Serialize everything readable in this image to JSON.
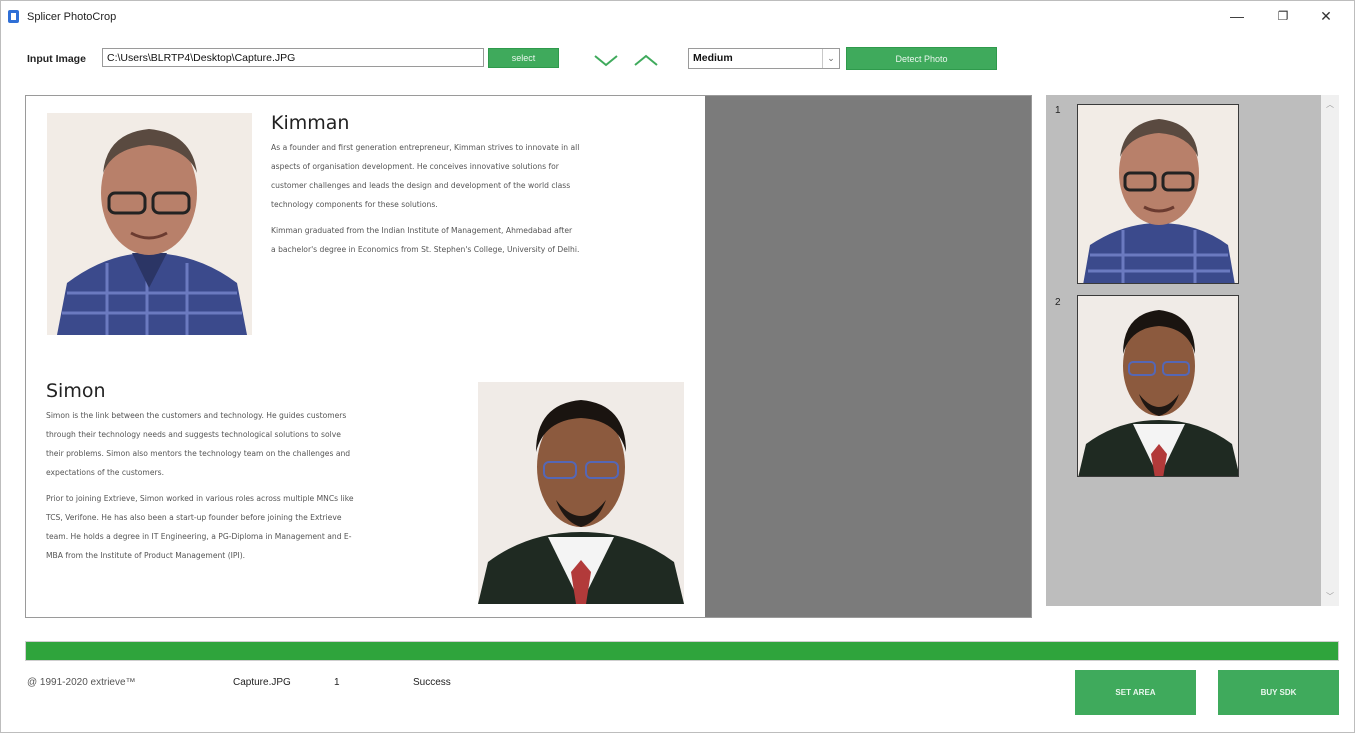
{
  "window": {
    "title": "Splicer PhotoCrop",
    "minimize": "—",
    "restore": "❐",
    "close": "✕"
  },
  "toolbar": {
    "input_label": "Input Image",
    "input_path": "C:\\Users\\BLRTP4\\Desktop\\Capture.JPG",
    "select_label": "select",
    "quality_value": "Medium",
    "detect_label": "Detect Photo"
  },
  "document": {
    "person1": {
      "name": "Kimman",
      "lines": [
        "As a founder and first generation entrepreneur, Kimman strives to innovate in all",
        "aspects of organisation development. He conceives innovative solutions for",
        "customer challenges and leads the design and development of the world class",
        "technology components for these solutions.",
        "Kimman graduated from the Indian Institute of Management, Ahmedabad after",
        "a bachelor's degree in Economics from St. Stephen's College, University of Delhi."
      ]
    },
    "person2": {
      "name": "Simon",
      "lines": [
        "Simon is the link between the customers and technology. He guides customers",
        "through their technology needs and suggests technological solutions to solve",
        "their problems. Simon also mentors the technology team on the challenges and",
        "expectations of the customers.",
        "Prior to joining Extrieve, Simon worked in various roles across multiple MNCs like",
        "TCS, Verifone. He has also been a start-up founder before joining the Extrieve",
        "team. He holds a degree in IT Engineering, a PG-Diploma in Management and E-",
        "MBA from the Institute of Product Management (IPI)."
      ]
    }
  },
  "results": [
    {
      "index": "1"
    },
    {
      "index": "2"
    }
  ],
  "progress": {
    "value": 1.0
  },
  "status": {
    "copyright": "@ 1991-2020 extrieve™",
    "filename": "Capture.JPG",
    "count": "1",
    "result": "Success"
  },
  "buttons": {
    "set_area": "SET AREA",
    "buy_sdk": "BUY SDK"
  },
  "colors": {
    "accent_green": "#3faa5c",
    "progress_green": "#2fa43c",
    "preview_gray": "#7b7b7b",
    "results_gray": "#bdbdbd"
  }
}
